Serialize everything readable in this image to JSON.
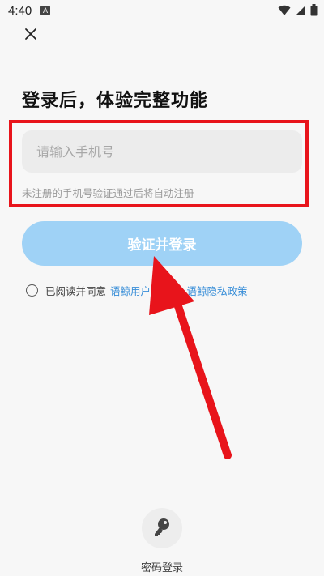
{
  "status_bar": {
    "time": "4:40",
    "notification_badge": "A",
    "icons": [
      "wifi-icon",
      "signal-icon",
      "battery-icon"
    ]
  },
  "login": {
    "title": "登录后，体验完整功能",
    "phone_placeholder": "请输入手机号",
    "phone_value": "",
    "hint": "未注册的手机号验证通过后将自动注册",
    "submit_label": "验证并登录",
    "agree_prefix": "已阅读并同意",
    "user_agreement": "语鲸用户协议",
    "and": "和",
    "privacy_policy": "语鲸隐私政策",
    "password_login_label": "密码登录"
  },
  "colors": {
    "accent": "#3a8fd8",
    "button_bg": "#9fd2f6",
    "annotation_red": "#e8141b"
  }
}
